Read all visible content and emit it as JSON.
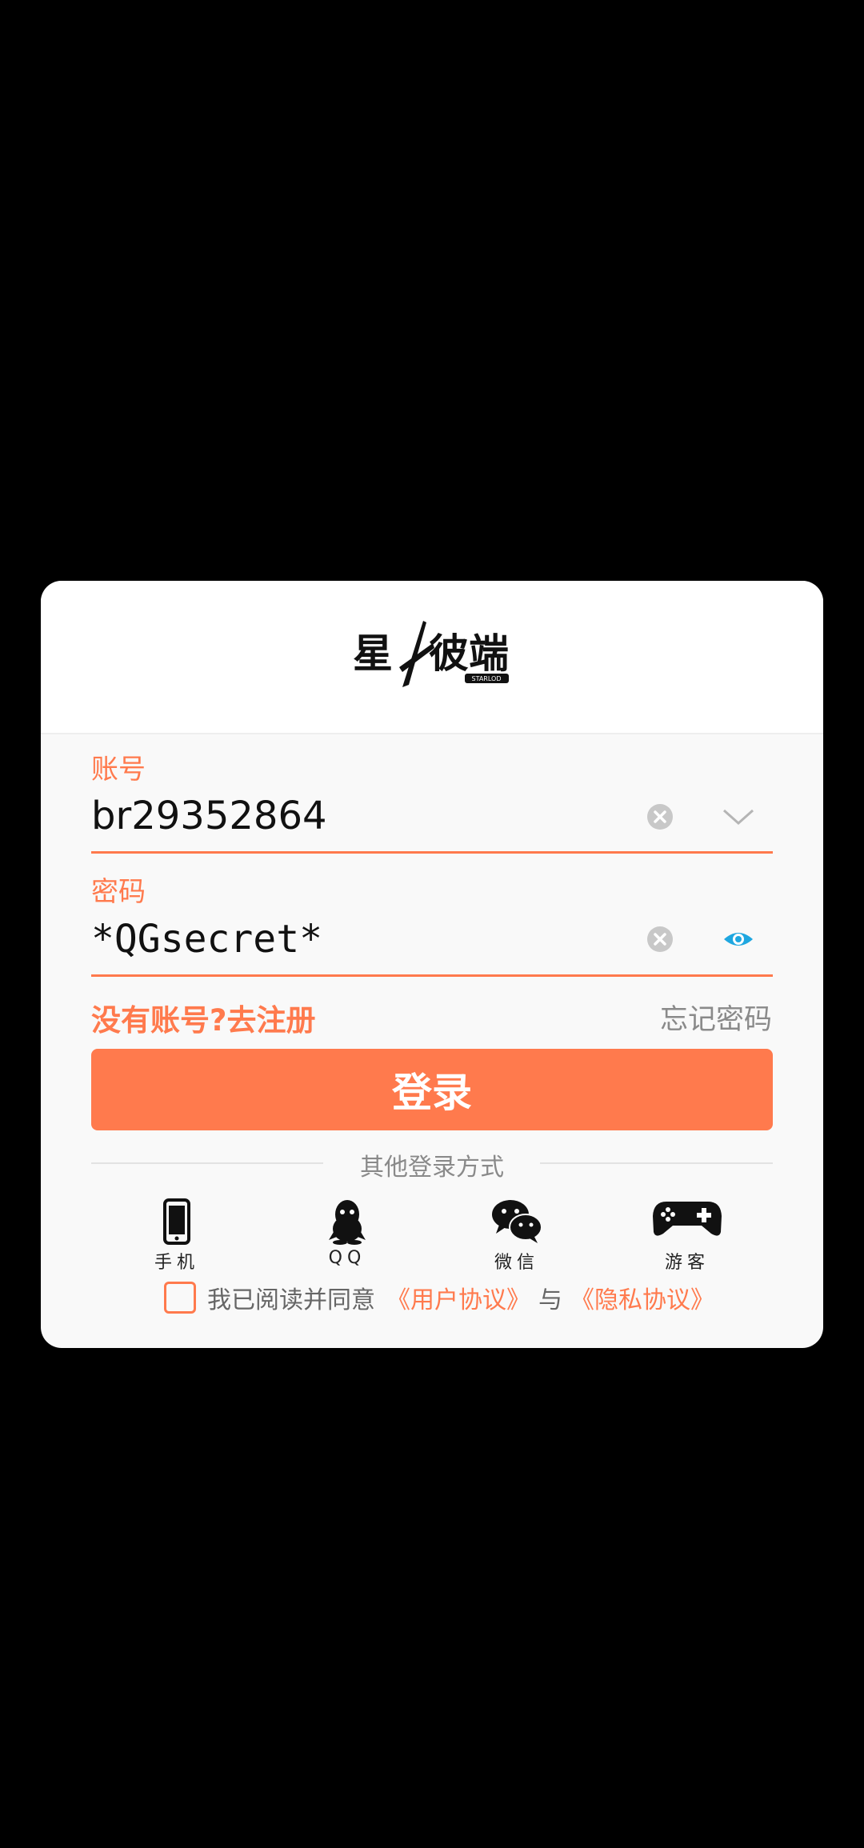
{
  "brand": {
    "logo_text": "星彼端",
    "logo_subtext": "STARLOD"
  },
  "account": {
    "label": "账号",
    "value": "br29352864"
  },
  "password": {
    "label": "密码",
    "value": "*QGsecret*"
  },
  "links": {
    "register": "没有账号?去注册",
    "forgot": "忘记密码"
  },
  "login_button": "登录",
  "other_methods": {
    "title": "其他登录方式",
    "items": [
      {
        "label": "手机",
        "icon": "phone-icon"
      },
      {
        "label": "QQ",
        "icon": "qq-icon"
      },
      {
        "label": "微信",
        "icon": "wechat-icon"
      },
      {
        "label": "游客",
        "icon": "gamepad-icon"
      }
    ]
  },
  "agreement": {
    "prefix": "我已阅读并同意",
    "user_agreement": "《用户协议》",
    "connector": "与",
    "privacy_agreement": "《隐私协议》"
  },
  "colors": {
    "accent": "#ff7a4d",
    "background": "#000000",
    "dialog": "#f9f9f9",
    "eye_icon": "#1fa7e0"
  }
}
